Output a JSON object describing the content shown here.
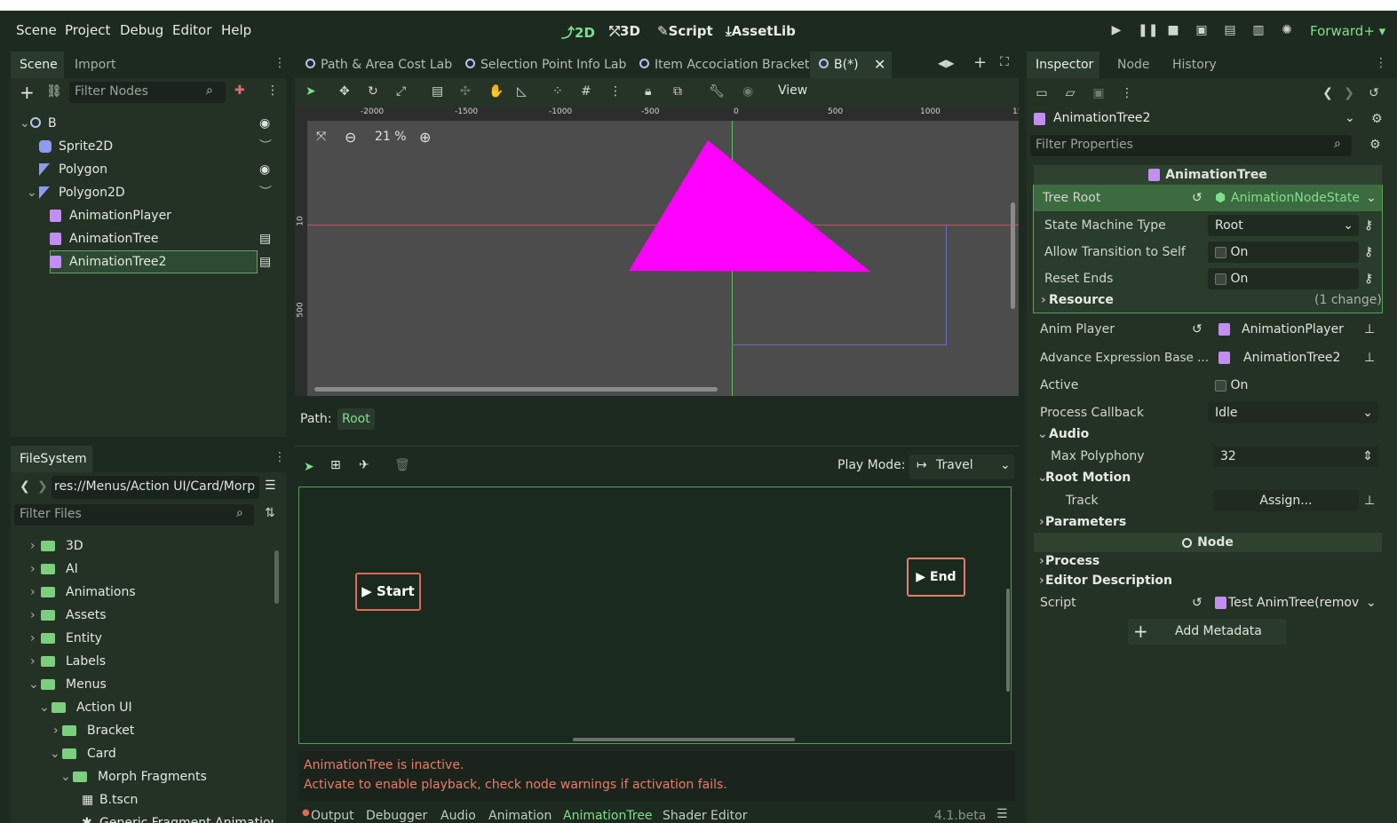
{
  "menu": {
    "scene": "Scene",
    "project": "Project",
    "debug": "Debug",
    "editor": "Editor",
    "help": "Help"
  },
  "modes": {
    "m2d": "2D",
    "m3d": "3D",
    "script": "Script",
    "assetlib": "AssetLib"
  },
  "renderer": "Forward+",
  "scene_dock": {
    "tabs": [
      "Scene",
      "Import"
    ],
    "filter_placeholder": "Filter Nodes",
    "nodes": [
      "B",
      "Sprite2D",
      "Polygon",
      "Polygon2D",
      "AnimationPlayer",
      "AnimationTree",
      "AnimationTree2"
    ]
  },
  "filesystem": {
    "tab": "FileSystem",
    "path": "res://Menus/Action UI/Card/Morp",
    "filter_placeholder": "Filter Files",
    "items": [
      "3D",
      "AI",
      "Animations",
      "Assets",
      "Entity",
      "Labels",
      "Menus",
      "Action UI",
      "Bracket",
      "Card",
      "Morph Fragments",
      "B.tscn",
      "Generic Fragment Animation Tr"
    ]
  },
  "editor_tabs": [
    "Path & Area Cost Lab",
    "Selection Point Info Lab",
    "Item Accociation Bracket",
    "B(*)"
  ],
  "viewport": {
    "view_menu": "View",
    "zoom": "21 %",
    "ruler_x": [
      "-2000",
      "-1500",
      "-1000",
      "-500",
      "0",
      "500",
      "1000",
      "15"
    ],
    "ruler_y": [
      "10",
      "500"
    ],
    "accent": "#ff00ff"
  },
  "animtree": {
    "path_label": "Path:",
    "path_value": "Root",
    "play_mode_label": "Play Mode:",
    "play_mode_value": "Travel",
    "start": "Start",
    "end": "End",
    "warning1": "AnimationTree is inactive.",
    "warning2": "Activate to enable playback, check node warnings if activation fails."
  },
  "bottom_tabs": [
    "Output",
    "Debugger",
    "Audio",
    "Animation",
    "AnimationTree",
    "Shader Editor"
  ],
  "version": "4.1.beta",
  "inspector": {
    "tabs": [
      "Inspector",
      "Node",
      "History"
    ],
    "object": "AnimationTree2",
    "filter_placeholder": "Filter Properties",
    "class_header": "AnimationTree",
    "tree_root_label": "Tree Root",
    "tree_root_value": "AnimationNodeState",
    "state_machine_type_label": "State Machine Type",
    "state_machine_type_value": "Root",
    "allow_transition_label": "Allow Transition to Self",
    "reset_ends_label": "Reset Ends",
    "on_label": "On",
    "resource_label": "Resource",
    "resource_changes": "(1 change)",
    "anim_player_label": "Anim Player",
    "anim_player_value": "AnimationPlayer",
    "adv_expr_label": "Advance Expression Base ...",
    "adv_expr_value": "AnimationTree2",
    "active_label": "Active",
    "process_callback_label": "Process Callback",
    "process_callback_value": "Idle",
    "audio_label": "Audio",
    "max_polyphony_label": "Max Polyphony",
    "max_polyphony_value": "32",
    "root_motion_label": "Root Motion",
    "track_label": "Track",
    "track_value": "Assign...",
    "parameters_label": "Parameters",
    "node_header": "Node",
    "process_label": "Process",
    "editor_desc_label": "Editor Description",
    "script_label": "Script",
    "script_value": "Test AnimTree(remov",
    "add_metadata": "Add Metadata"
  }
}
